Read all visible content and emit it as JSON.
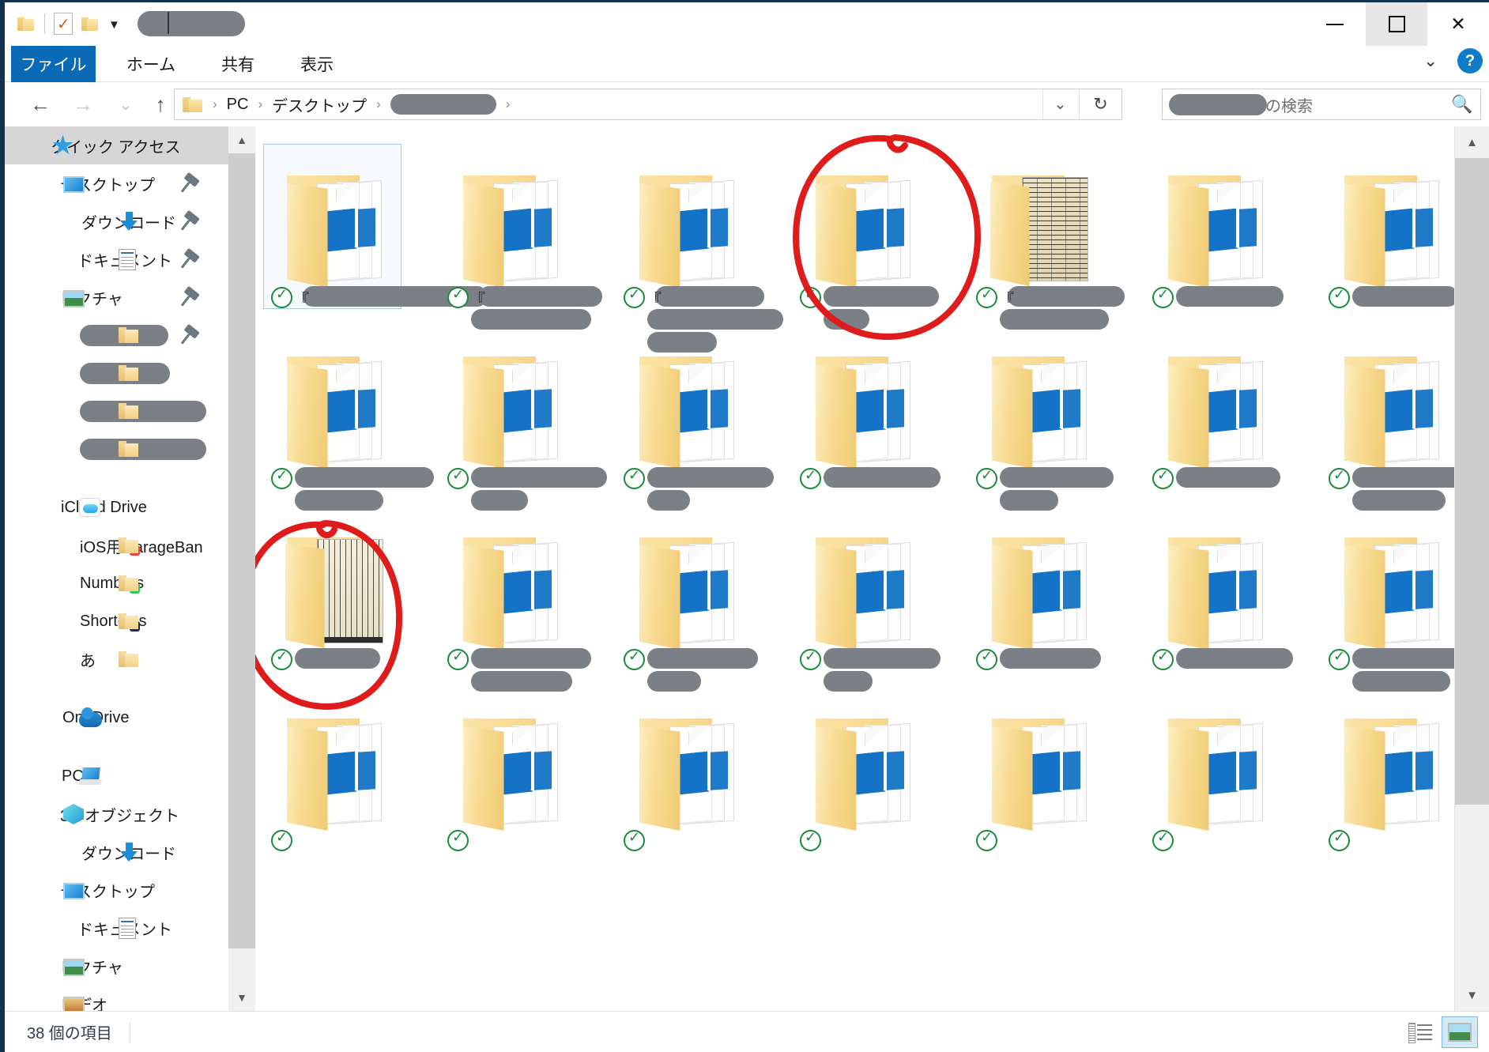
{
  "window": {
    "title_redacted": true,
    "quick_access_toolbar": [
      {
        "name": "folder-icon",
        "label": ""
      },
      {
        "name": "properties-icon",
        "label": ""
      },
      {
        "name": "new-folder-icon",
        "label": ""
      },
      {
        "name": "customize-caret-icon",
        "label": ""
      }
    ],
    "controls": {
      "minimize": "—",
      "maximize": "□",
      "close": "✕"
    }
  },
  "ribbon": {
    "tabs": [
      {
        "label": "ファイル",
        "active": true
      },
      {
        "label": "ホーム",
        "active": false
      },
      {
        "label": "共有",
        "active": false
      },
      {
        "label": "表示",
        "active": false
      }
    ],
    "collapse_icon": "⌄",
    "help_label": "?"
  },
  "navigation": {
    "back_icon": "←",
    "forward_icon": "→",
    "recent_icon": "⌄",
    "up_icon": "↑",
    "breadcrumb": [
      {
        "label": "PC",
        "redacted": false
      },
      {
        "label": "デスクトップ",
        "redacted": false
      },
      {
        "label": "",
        "redacted": true
      }
    ],
    "separator": "›",
    "dropdown_icon": "⌄",
    "refresh_icon": "↻"
  },
  "search": {
    "scope_redacted": true,
    "placeholder_suffix": "の検索",
    "icon": "⌕"
  },
  "sidebar": {
    "items": [
      {
        "label": "クイック アクセス",
        "icon": "star-icon",
        "level": 0,
        "header": true,
        "pinned": false,
        "redacted": false
      },
      {
        "label": "デスクトップ",
        "icon": "desktop-icon",
        "level": 1,
        "pinned": true,
        "redacted": false
      },
      {
        "label": "ダウンロード",
        "icon": "download-icon",
        "level": 1,
        "pinned": true,
        "redacted": false
      },
      {
        "label": "ドキュメント",
        "icon": "document-icon",
        "level": 1,
        "pinned": true,
        "redacted": false
      },
      {
        "label": "ピクチャ",
        "icon": "pictures-icon",
        "level": 1,
        "pinned": true,
        "redacted": false
      },
      {
        "label": "",
        "icon": "folder-icon",
        "level": 1,
        "pinned": true,
        "redacted": true,
        "redact_width": 112
      },
      {
        "label": "",
        "icon": "folder-icon",
        "level": 1,
        "pinned": false,
        "redacted": true,
        "redact_width": 114
      },
      {
        "label": "",
        "icon": "folder-icon",
        "level": 1,
        "pinned": false,
        "redacted": true,
        "redact_width": 160
      },
      {
        "label": "",
        "icon": "folder-icon",
        "level": 1,
        "pinned": false,
        "redacted": true,
        "redact_width": 160
      },
      {
        "gap": true
      },
      {
        "label": "iCloud Drive",
        "icon": "icloud-icon",
        "level": 0,
        "pinned": false,
        "redacted": false
      },
      {
        "label": "iOS用GarageBan",
        "icon": "folder-garageband-icon",
        "level": 1,
        "pinned": false,
        "redacted": false
      },
      {
        "label": "Numbers",
        "icon": "folder-numbers-icon",
        "level": 1,
        "pinned": false,
        "redacted": false
      },
      {
        "label": "Shortcuts",
        "icon": "folder-shortcuts-icon",
        "level": 1,
        "pinned": false,
        "redacted": false
      },
      {
        "label": "あ",
        "icon": "folder-icon",
        "level": 1,
        "pinned": false,
        "redacted": false
      },
      {
        "gap": true
      },
      {
        "label": "OneDrive",
        "icon": "onedrive-icon",
        "level": 0,
        "pinned": false,
        "redacted": false
      },
      {
        "gap": true
      },
      {
        "label": "PC",
        "icon": "pc-icon",
        "level": 0,
        "pinned": false,
        "redacted": false
      },
      {
        "label": "3D オブジェクト",
        "icon": "3d-objects-icon",
        "level": 1,
        "pinned": false,
        "redacted": false
      },
      {
        "label": "ダウンロード",
        "icon": "download-icon",
        "level": 1,
        "pinned": false,
        "redacted": false
      },
      {
        "label": "デスクトップ",
        "icon": "desktop-icon",
        "level": 1,
        "pinned": false,
        "redacted": false
      },
      {
        "label": "ドキュメント",
        "icon": "document-icon",
        "level": 1,
        "pinned": false,
        "redacted": false
      },
      {
        "label": "ピクチャ",
        "icon": "pictures-icon",
        "level": 1,
        "pinned": false,
        "redacted": false
      },
      {
        "label": "ビデオ",
        "icon": "videos-icon",
        "level": 1,
        "pinned": false,
        "redacted": false
      }
    ]
  },
  "files": {
    "view_mode": "extra-large-icons",
    "selected_index": 0,
    "items": [
      {
        "id": 0,
        "icon": "picture-folder-icon",
        "selected": true,
        "sync": "synced",
        "brackets": true,
        "label_lines": [
          234
        ]
      },
      {
        "id": 1,
        "icon": "picture-folder-icon",
        "selected": false,
        "sync": "synced",
        "brackets": true,
        "label_lines": [
          156,
          152
        ]
      },
      {
        "id": 2,
        "icon": "picture-folder-icon",
        "selected": false,
        "sync": "synced",
        "brackets": true,
        "label_lines": [
          138,
          172,
          88
        ]
      },
      {
        "id": 3,
        "icon": "picture-folder-icon",
        "selected": false,
        "sync": "synced",
        "brackets": false,
        "label_lines": [
          146,
          58
        ]
      },
      {
        "id": 4,
        "icon": "newspaper-preview-folder-icon",
        "selected": false,
        "sync": "synced",
        "brackets": true,
        "label_lines": [
          148,
          138
        ]
      },
      {
        "id": 5,
        "icon": "picture-folder-icon",
        "selected": false,
        "sync": "synced",
        "brackets": false,
        "label_lines": [
          136
        ]
      },
      {
        "id": 6,
        "icon": "picture-folder-icon",
        "selected": false,
        "sync": "synced",
        "brackets": false,
        "label_lines": [
          134
        ]
      },
      {
        "id": 7,
        "icon": "picture-folder-icon",
        "selected": false,
        "sync": "synced",
        "brackets": false,
        "label_lines": [
          176,
          112
        ]
      },
      {
        "id": 8,
        "icon": "picture-folder-icon",
        "selected": false,
        "sync": "synced",
        "brackets": false,
        "label_lines": [
          172,
          72
        ]
      },
      {
        "id": 9,
        "icon": "picture-folder-icon",
        "selected": false,
        "sync": "synced",
        "brackets": false,
        "label_lines": [
          160,
          54
        ]
      },
      {
        "id": 10,
        "icon": "picture-folder-icon",
        "selected": false,
        "sync": "synced",
        "brackets": false,
        "label_lines": [
          148
        ]
      },
      {
        "id": 11,
        "icon": "picture-folder-icon",
        "selected": false,
        "sync": "synced",
        "brackets": false,
        "label_lines": [
          144,
          74
        ]
      },
      {
        "id": 12,
        "icon": "picture-folder-icon",
        "selected": false,
        "sync": "synced",
        "brackets": false,
        "label_lines": [
          132
        ]
      },
      {
        "id": 13,
        "icon": "picture-folder-icon",
        "selected": false,
        "sync": "synced",
        "brackets": false,
        "label_lines": [
          152,
          118
        ]
      },
      {
        "id": 14,
        "icon": "book-preview-folder-icon",
        "selected": false,
        "sync": "synced",
        "brackets": false,
        "label_lines": [
          108
        ]
      },
      {
        "id": 15,
        "icon": "picture-folder-icon",
        "selected": false,
        "sync": "synced",
        "brackets": false,
        "label_lines": [
          152,
          128
        ]
      },
      {
        "id": 16,
        "icon": "picture-folder-icon",
        "selected": false,
        "sync": "synced",
        "brackets": false,
        "label_lines": [
          140,
          68
        ]
      },
      {
        "id": 17,
        "icon": "picture-folder-icon",
        "selected": false,
        "sync": "synced",
        "brackets": false,
        "label_lines": [
          148,
          62
        ]
      },
      {
        "id": 18,
        "icon": "picture-folder-icon",
        "selected": false,
        "sync": "synced",
        "brackets": false,
        "label_lines": [
          128
        ]
      },
      {
        "id": 19,
        "icon": "picture-folder-icon",
        "selected": false,
        "sync": "synced",
        "brackets": false,
        "label_lines": [
          148
        ]
      },
      {
        "id": 20,
        "icon": "picture-folder-icon",
        "selected": false,
        "sync": "synced",
        "brackets": false,
        "label_lines": [
          146,
          124
        ]
      },
      {
        "id": 21,
        "icon": "picture-folder-icon",
        "selected": false,
        "sync": "synced",
        "brackets": false,
        "label_lines": [
          0
        ]
      },
      {
        "id": 22,
        "icon": "picture-folder-icon",
        "selected": false,
        "sync": "synced",
        "brackets": false,
        "label_lines": [
          0
        ]
      },
      {
        "id": 23,
        "icon": "picture-folder-icon",
        "selected": false,
        "sync": "synced",
        "brackets": false,
        "label_lines": [
          0
        ]
      },
      {
        "id": 24,
        "icon": "picture-folder-icon",
        "selected": false,
        "sync": "synced",
        "brackets": false,
        "label_lines": [
          0
        ]
      },
      {
        "id": 25,
        "icon": "picture-folder-icon",
        "selected": false,
        "sync": "synced",
        "brackets": false,
        "label_lines": [
          0
        ]
      },
      {
        "id": 26,
        "icon": "picture-folder-icon",
        "selected": false,
        "sync": "synced",
        "brackets": false,
        "label_lines": [
          0
        ]
      },
      {
        "id": 27,
        "icon": "picture-folder-icon",
        "selected": false,
        "sync": "synced",
        "brackets": false,
        "label_lines": [
          0
        ]
      }
    ]
  },
  "annotations": [
    {
      "name": "red-circle-newspaper-folder",
      "shape": "hand-drawn-ellipse",
      "color": "#e01b1b"
    },
    {
      "name": "red-circle-book-folder",
      "shape": "hand-drawn-ellipse",
      "color": "#e01b1b"
    }
  ],
  "statusbar": {
    "item_count_text": "38 個の項目",
    "view_details_label": "",
    "view_large_icons_label": ""
  },
  "colors": {
    "accent": "#0b6ab5",
    "annotation_red": "#e01b1b",
    "sync_green": "#1a8a3c",
    "redaction_gray": "#7b7f86",
    "folder_yellow": "#f5d88f",
    "titlebar_border": "#13314f"
  }
}
